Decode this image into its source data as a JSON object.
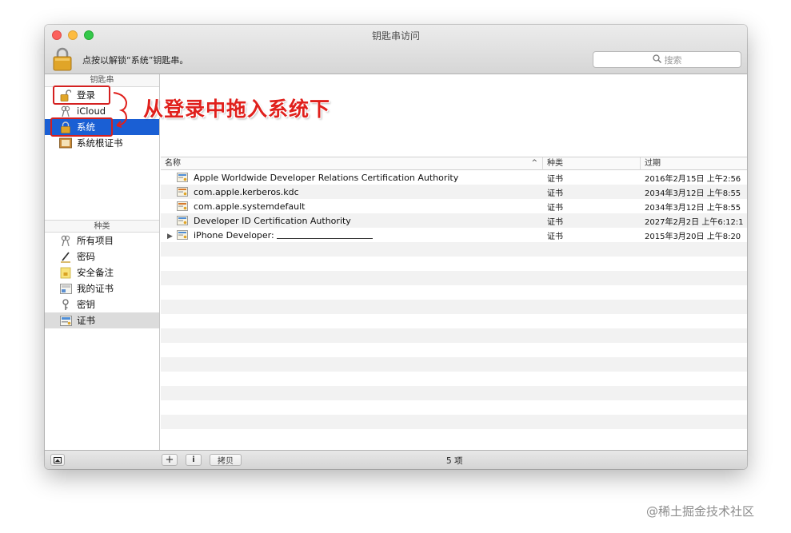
{
  "window": {
    "title": "钥匙串访问"
  },
  "toolbar": {
    "lock_message": "点按以解锁“系统”钥匙串。",
    "search_placeholder": "搜索"
  },
  "sidebar": {
    "keychains_header": "钥匙串",
    "keychains": [
      {
        "label": "登录",
        "icon": "lock-open-icon"
      },
      {
        "label": "iCloud",
        "icon": "cloud-keys-icon"
      },
      {
        "label": "系统",
        "icon": "lock-closed-icon",
        "selected": true
      },
      {
        "label": "系统根证书",
        "icon": "cabinet-icon"
      }
    ],
    "categories_header": "种类",
    "categories": [
      {
        "label": "所有项目",
        "icon": "keys-icon"
      },
      {
        "label": "密码",
        "icon": "pen-icon"
      },
      {
        "label": "安全备注",
        "icon": "note-icon"
      },
      {
        "label": "我的证书",
        "icon": "my-cert-icon"
      },
      {
        "label": "密钥",
        "icon": "key-icon"
      },
      {
        "label": "证书",
        "icon": "certificate-icon",
        "selected": true
      }
    ]
  },
  "table": {
    "columns": [
      "名称",
      "种类",
      "过期"
    ],
    "rows": [
      {
        "name": "Apple Worldwide Developer Relations Certification Authority",
        "kind": "证书",
        "expires": "2016年2月15日 上午2:56"
      },
      {
        "name": "com.apple.kerberos.kdc",
        "kind": "证书",
        "expires": "2034年3月12日 上午8:55"
      },
      {
        "name": "com.apple.systemdefault",
        "kind": "证书",
        "expires": "2034年3月12日 上午8:55"
      },
      {
        "name": "Developer ID Certification Authority",
        "kind": "证书",
        "expires": "2027年2月2日 上午6:12:1"
      },
      {
        "name": "iPhone Developer:",
        "kind": "证书",
        "expires": "2015年3月20日 上午8:20"
      }
    ]
  },
  "bottombar": {
    "add_label": "+",
    "info_label": "i",
    "copy_label": "拷贝",
    "count_label": "5 项"
  },
  "annotation": {
    "text": "从登录中拖入系统下",
    "color": "#e0201c"
  },
  "watermark": "@稀土掘金技术社区"
}
